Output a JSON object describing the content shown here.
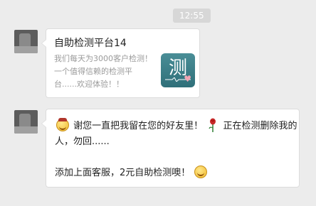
{
  "timestamp": "12:55",
  "messages": [
    {
      "type": "link_card",
      "title": "自助检测平台14",
      "description": "我们每天为3000客户检测！一个值得信赖的检测平台......欢迎体验！！",
      "thumbnail_char": "测"
    },
    {
      "type": "text",
      "line1_part1": "谢您一直把我留在您的好友里！",
      "line1_part2": "正在检测删除我的人，勿回......",
      "line2": "添加上面客服，2元自助检测噢！"
    }
  ],
  "icons": {
    "emoji1": "grin-emoji-icon",
    "rose": "rose-icon",
    "emoji2": "smile-emoji-icon"
  },
  "colors": {
    "background": "#ececec",
    "bubble": "#ffffff",
    "thumbnail": "#3d7f88"
  }
}
